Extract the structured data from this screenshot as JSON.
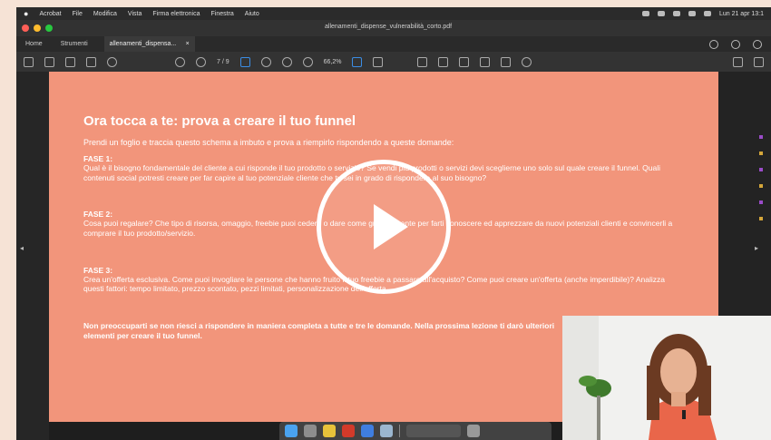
{
  "menubar": {
    "items": [
      "Acrobat",
      "File",
      "Modifica",
      "Vista",
      "Firma elettronica",
      "Finestra",
      "Aiuto"
    ],
    "clock": "Lun 21 apr 13:1"
  },
  "window": {
    "title": "allenamenti_dispense_vulnerabilità_corto.pdf"
  },
  "tabs": {
    "home": "Home",
    "documents": "Strumenti",
    "active": "allenamenti_dispensa...",
    "active_close": "×"
  },
  "toolbar": {
    "page_indicator": "7 / 9",
    "zoom": "66,2%"
  },
  "document": {
    "title": "Ora tocca a te: prova a creare il tuo funnel",
    "intro": "Prendi un foglio e traccia questo schema a imbuto e prova a riempirlo rispondendo a queste domande:",
    "phases": [
      {
        "heading": "FASE 1:",
        "body": "Qual è il bisogno fondamentale del cliente a cui risponde il tuo prodotto o servizio? Se vendi più prodotti o servizi devi sceglierne uno solo sul quale creare il funnel. Quali contenuti social potresti creare per far capire al tuo potenziale cliente che tu sei in grado di rispondere al suo bisogno?"
      },
      {
        "heading": "FASE 2:",
        "body": "Cosa puoi regalare? Che tipo di risorsa, omaggio, freebie puoi cedere o dare come gratuitamente per farti conoscere ed apprezzare da nuovi potenziali clienti e convincerli a comprare il tuo prodotto/servizio."
      },
      {
        "heading": "FASE 3:",
        "body": "Crea un'offerta esclusiva. Come puoi invogliare le persone che hanno fruito il tuo freebie a passare all'acquisto? Come puoi creare un'offerta (anche imperdibile)? Analizza questi fattori: tempo limitato, prezzo scontato, pezzi limitati, personalizzazione dell'offerta."
      }
    ],
    "closing": "Non preoccuparti se non riesci a rispondere in maniera completa a tutte e tre le domande. Nella prossima lezione ti darò ulteriori elementi per creare il tuo funnel."
  }
}
